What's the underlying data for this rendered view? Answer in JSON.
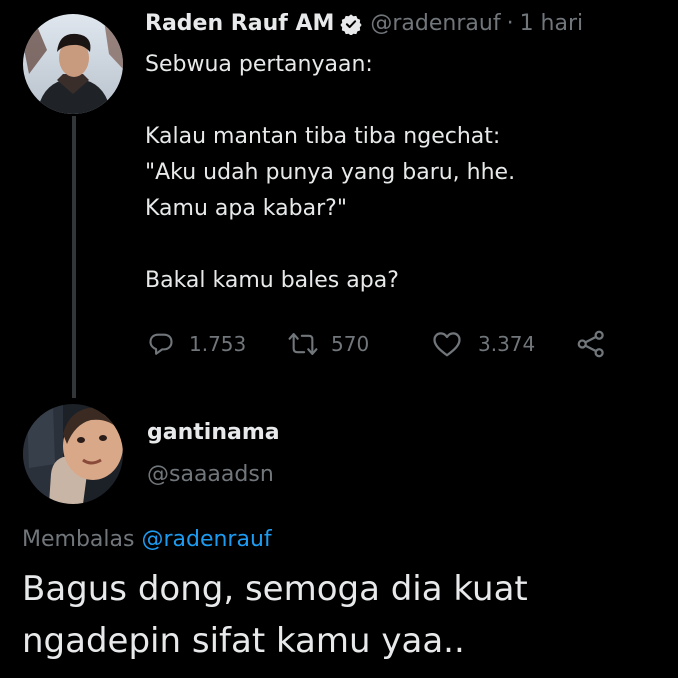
{
  "original_tweet": {
    "author_name": "Raden Rauf AM",
    "handle": "@radenrauf",
    "separator": "·",
    "time": "1 hari",
    "verified": true,
    "text": "Sebwua pertanyaan:\n\nKalau mantan tiba tiba ngechat:\n\"Aku udah punya yang baru, hhe.\nKamu apa kabar?\"\n\nBakal kamu bales apa?",
    "actions": {
      "reply_count": "1.753",
      "retweet_count": "570",
      "like_count": "3.374"
    }
  },
  "reply_tweet": {
    "author_name": "gantinama",
    "handle": "@saaaadsn",
    "replying_to_prefix": "Membalas",
    "replying_to_handle": "@radenrauf",
    "text": "Bagus dong, semoga dia kuat\nngadepin sifat kamu yaa.."
  },
  "colors": {
    "background": "#000000",
    "primary_text": "#e7e9ea",
    "secondary_text": "#71767b",
    "link": "#1d9bf0",
    "thread_line": "#333639"
  },
  "icons": {
    "verified": "verified-badge-icon",
    "reply": "reply-icon",
    "retweet": "retweet-icon",
    "like": "like-icon",
    "share": "share-icon"
  }
}
